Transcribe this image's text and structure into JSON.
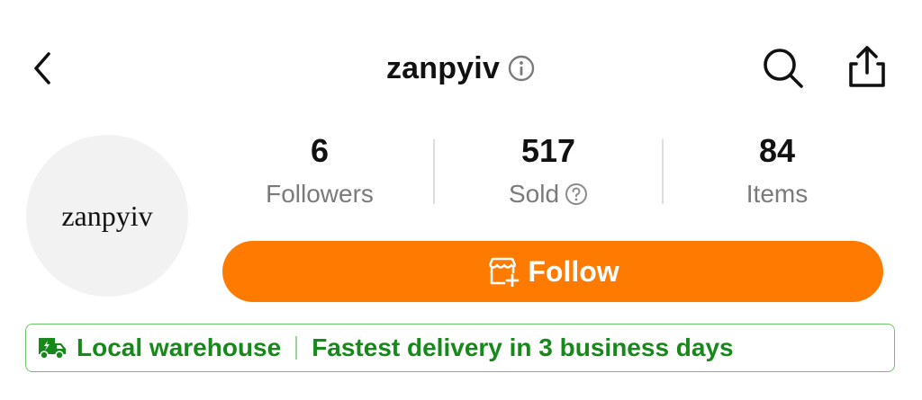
{
  "header": {
    "title": "zanpyiv",
    "icons": {
      "back": "chevron-left-icon",
      "info": "info-icon",
      "search": "search-icon",
      "share": "share-icon"
    }
  },
  "avatar": {
    "text": "zanpyiv"
  },
  "stats": {
    "followers": {
      "value": "6",
      "label": "Followers"
    },
    "sold": {
      "value": "517",
      "label": "Sold"
    },
    "items": {
      "value": "84",
      "label": "Items"
    }
  },
  "follow": {
    "label": "Follow",
    "icon": "store-plus-icon"
  },
  "banner": {
    "icon": "delivery-truck-icon",
    "left": "Local warehouse",
    "right": "Fastest delivery in 3 business days"
  },
  "colors": {
    "accent": "#ff7a00",
    "banner_green": "#16891a",
    "banner_border": "#6cc36a"
  }
}
